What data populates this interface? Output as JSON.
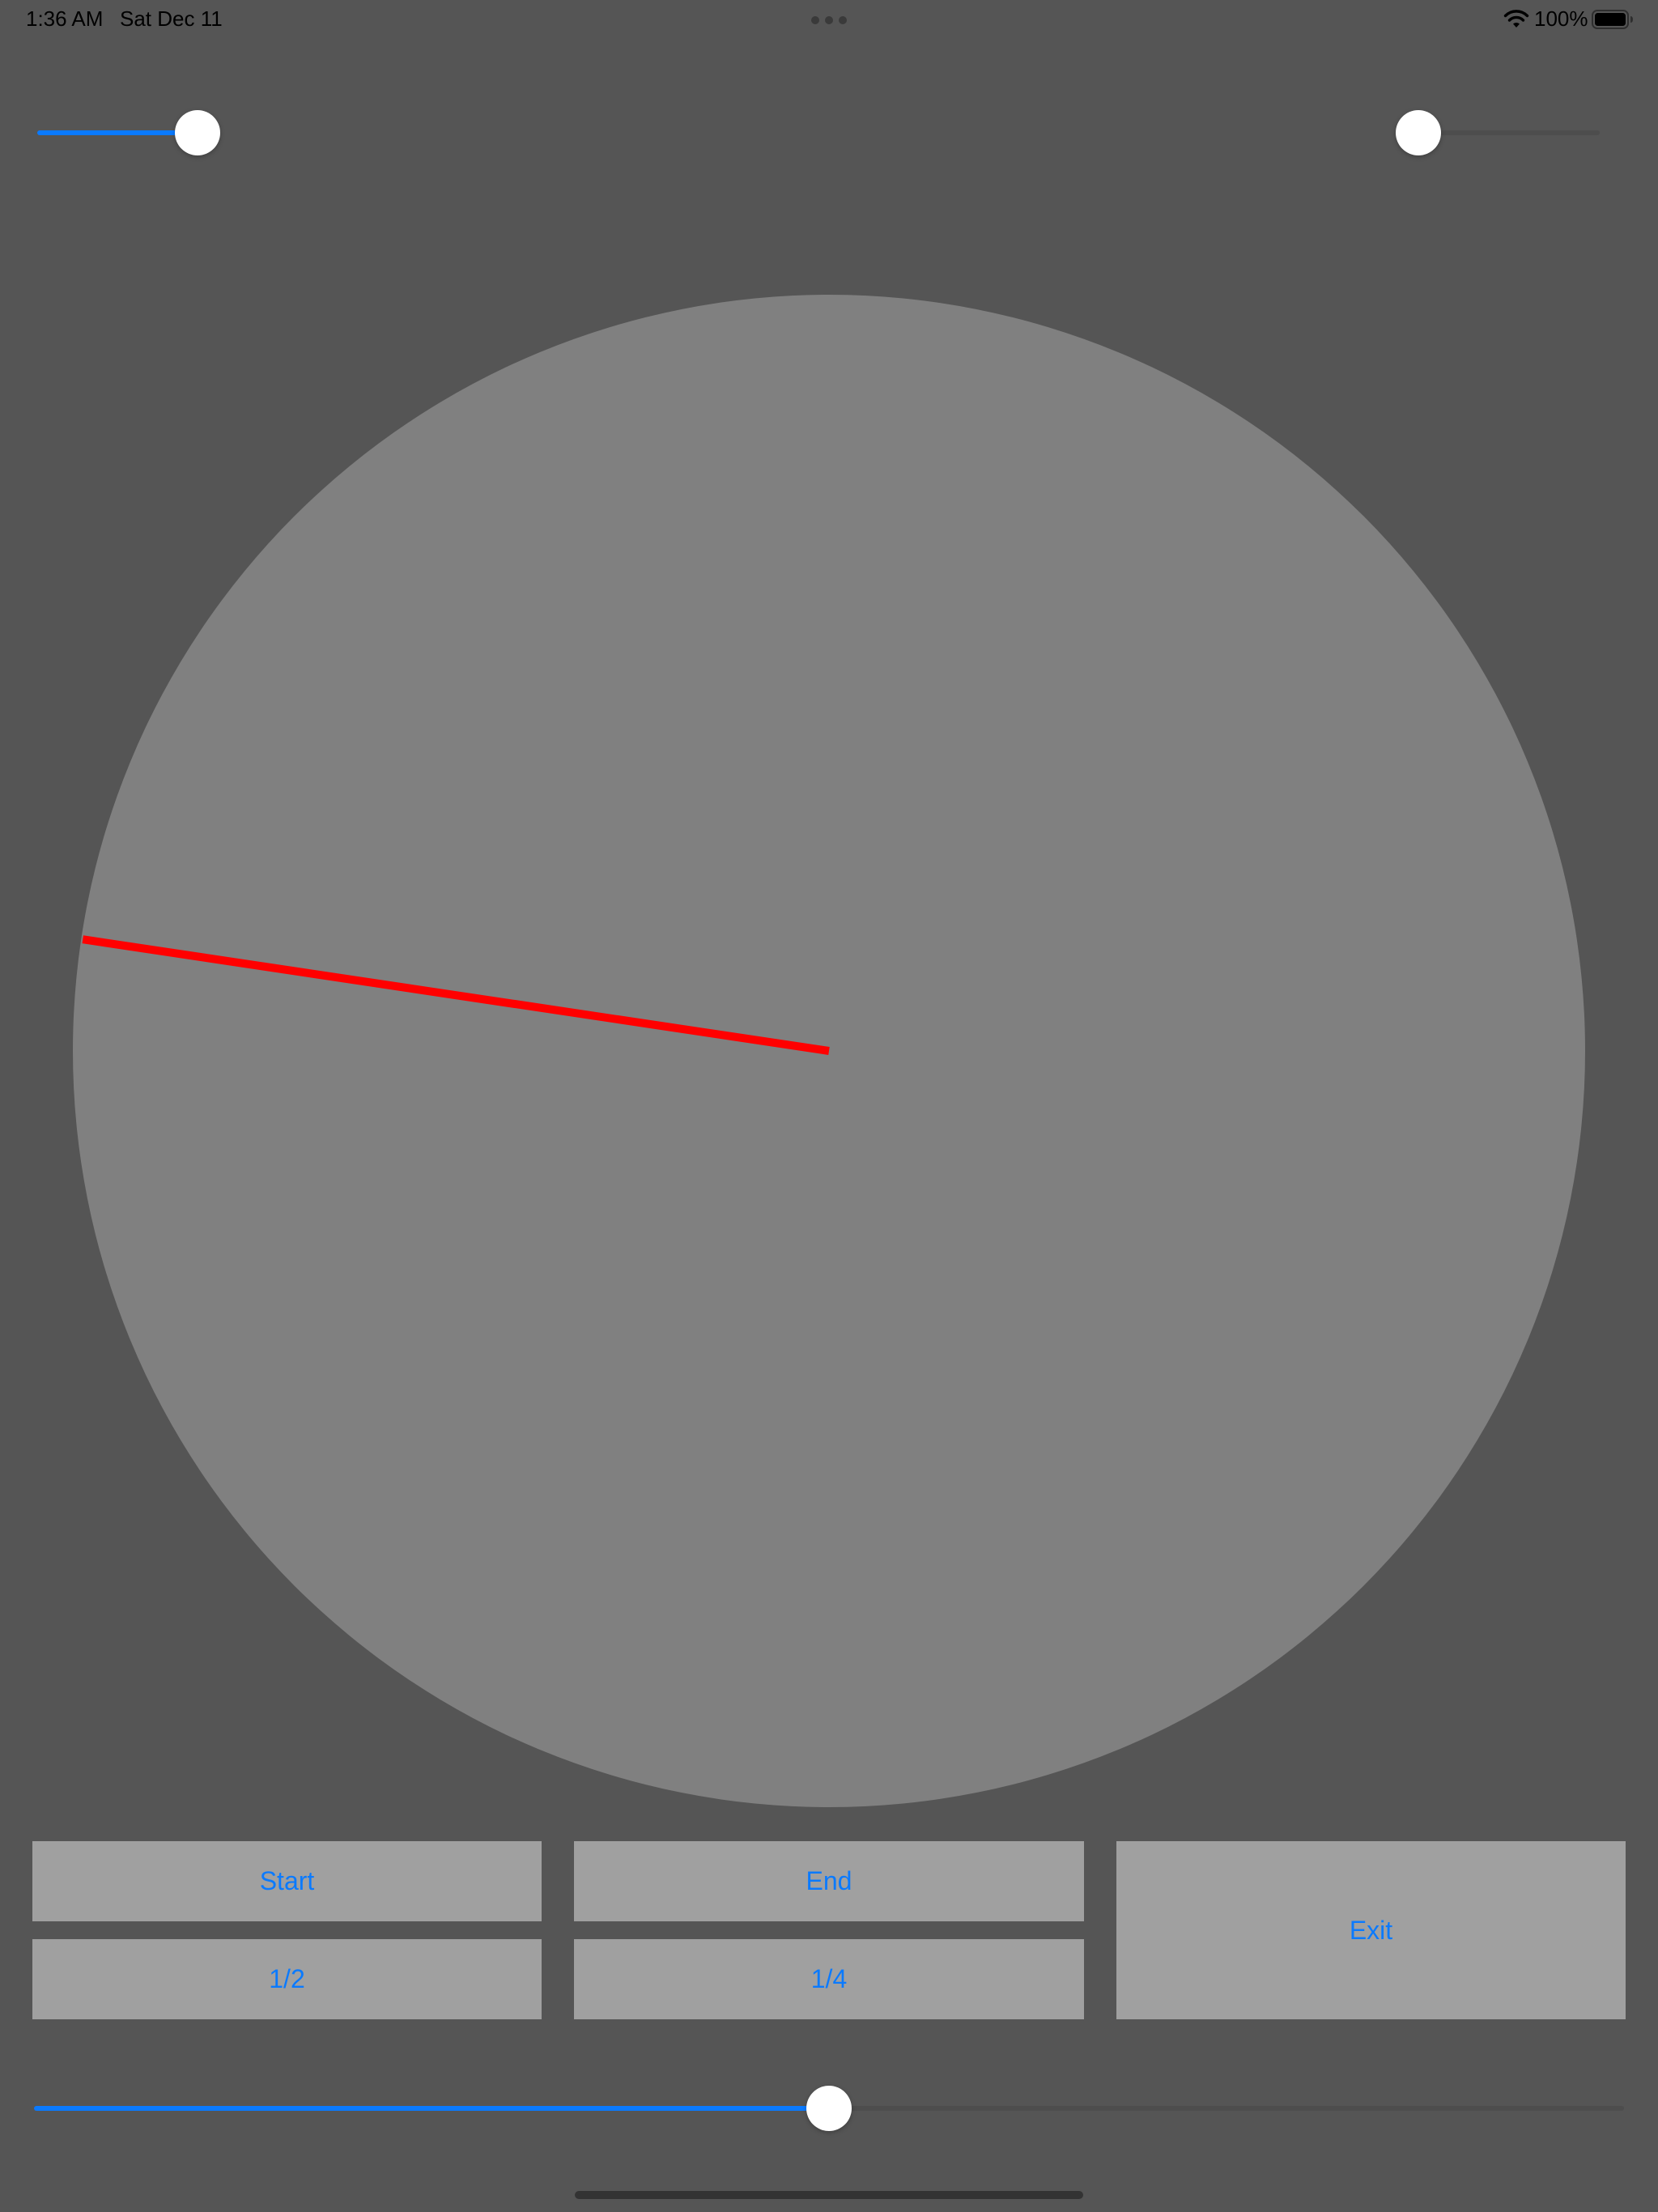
{
  "status_bar": {
    "time": "1:36 AM",
    "date": "Sat Dec 11",
    "battery_percent": "100%",
    "icons": [
      "wifi-icon",
      "battery-icon"
    ]
  },
  "sliders": {
    "top_left": {
      "value": 1.0
    },
    "top_right": {
      "value": 0.0
    },
    "bottom": {
      "value": 0.5
    }
  },
  "dial": {
    "hand_angle_deg": 171.5,
    "hand_color": "#ff0000",
    "face_color": "#808080"
  },
  "buttons": {
    "start": "Start",
    "end": "End",
    "exit": "Exit",
    "half": "1/2",
    "quarter": "1/4"
  },
  "colors": {
    "background": "#555555",
    "accent": "#0a7aff",
    "button_bg": "#a0a0a0",
    "thumb": "#ffffff"
  }
}
